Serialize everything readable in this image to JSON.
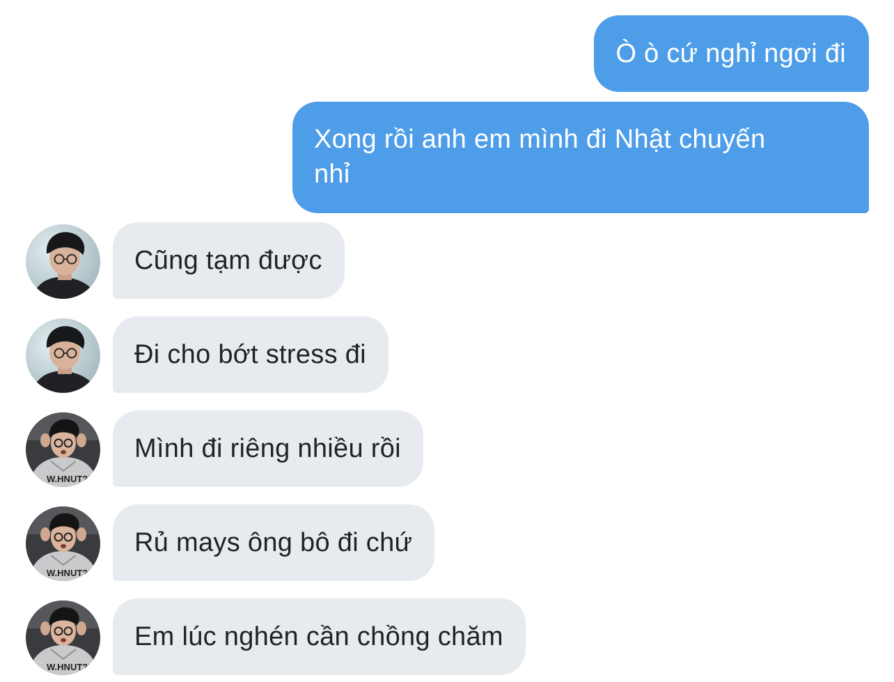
{
  "conversation": {
    "outgoing": [
      {
        "text": "Ò ò cứ nghỉ ngơi đi"
      },
      {
        "line1": "Xong rồi anh em mình đi Nhật chuyến",
        "line2": "nhỉ"
      }
    ],
    "incoming": [
      {
        "text": "Cũng tạm được",
        "avatar": "avatar-person-glasses-dark-jacket"
      },
      {
        "text": "Đi cho bớt stress đi",
        "avatar": "avatar-person-glasses-dark-jacket"
      },
      {
        "text": "Mình đi riêng nhiều rồi",
        "avatar": "avatar-person-grey-hoodie"
      },
      {
        "text": "Rủ mays ông bô đi chứ",
        "avatar": "avatar-person-grey-hoodie"
      },
      {
        "text": "Em lúc nghén cần chồng chăm",
        "avatar": "avatar-person-grey-hoodie"
      }
    ],
    "hoodie_print": "W.HNUT?!"
  },
  "colors": {
    "outgoing_bubble": "#4e9de8",
    "incoming_bubble": "#e7ebef",
    "incoming_text": "#1f2326",
    "background": "#ffffff"
  }
}
